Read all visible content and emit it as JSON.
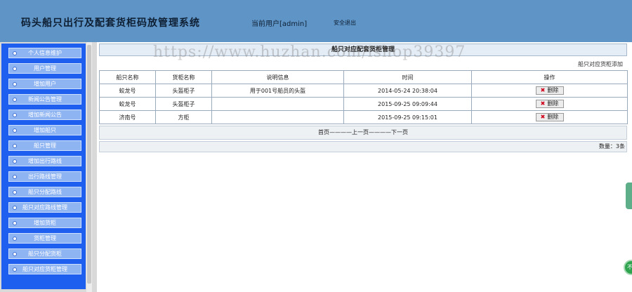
{
  "header": {
    "system_title": "码头船只出行及配套货柜码放管理系统",
    "current_user": "当前用户[admin]",
    "logout": "安全退出"
  },
  "sidebar": {
    "items": [
      {
        "label": "个人信息维护"
      },
      {
        "label": "用户管理"
      },
      {
        "label": "增加用户"
      },
      {
        "label": "新闻公告管理"
      },
      {
        "label": "增加新闻公告"
      },
      {
        "label": "增加船只"
      },
      {
        "label": "船只管理"
      },
      {
        "label": "增加出行路线"
      },
      {
        "label": "出行路线管理"
      },
      {
        "label": "船只分配路线"
      },
      {
        "label": "船只对应路线管理"
      },
      {
        "label": "增加货柜"
      },
      {
        "label": "货柜管理"
      },
      {
        "label": "船只分配货柜"
      },
      {
        "label": "船只对应货柜管理"
      }
    ]
  },
  "main": {
    "panel_title": "船只对应配套货柜管理",
    "add_link": "船只对应货柜添加",
    "columns": [
      "船只名称",
      "货柜名称",
      "说明信息",
      "时间",
      "操作"
    ],
    "rows": [
      {
        "ship": "蛟龙号",
        "container": "头盔柜子",
        "note": "用于001号船员的头盔",
        "time": "2014-05-24 20:38:04",
        "action": "删除"
      },
      {
        "ship": "蛟龙号",
        "container": "头盔柜子",
        "note": "",
        "time": "2015-09-25 09:09:44",
        "action": "删除"
      },
      {
        "ship": "济南号",
        "container": "方柜",
        "note": "",
        "time": "2015-09-25 09:15:01",
        "action": "删除"
      }
    ],
    "pager": {
      "first": "首页",
      "prev": "上一页",
      "next": "下一页",
      "sep": "————"
    },
    "count": "数量：3条"
  },
  "watermark": "https://www.huzhan.com/ishop39397",
  "float_button": "不",
  "colors": {
    "header_bg": "#5e94c6",
    "sidebar_bg": "#1e5ff0",
    "menu_item_bg": "#8fb4f2",
    "delete_icon": "#d0021b",
    "float_button": "#2ea44f"
  },
  "icons": {
    "menu_bullet": "bullet-icon",
    "delete": "delete-x-icon"
  }
}
